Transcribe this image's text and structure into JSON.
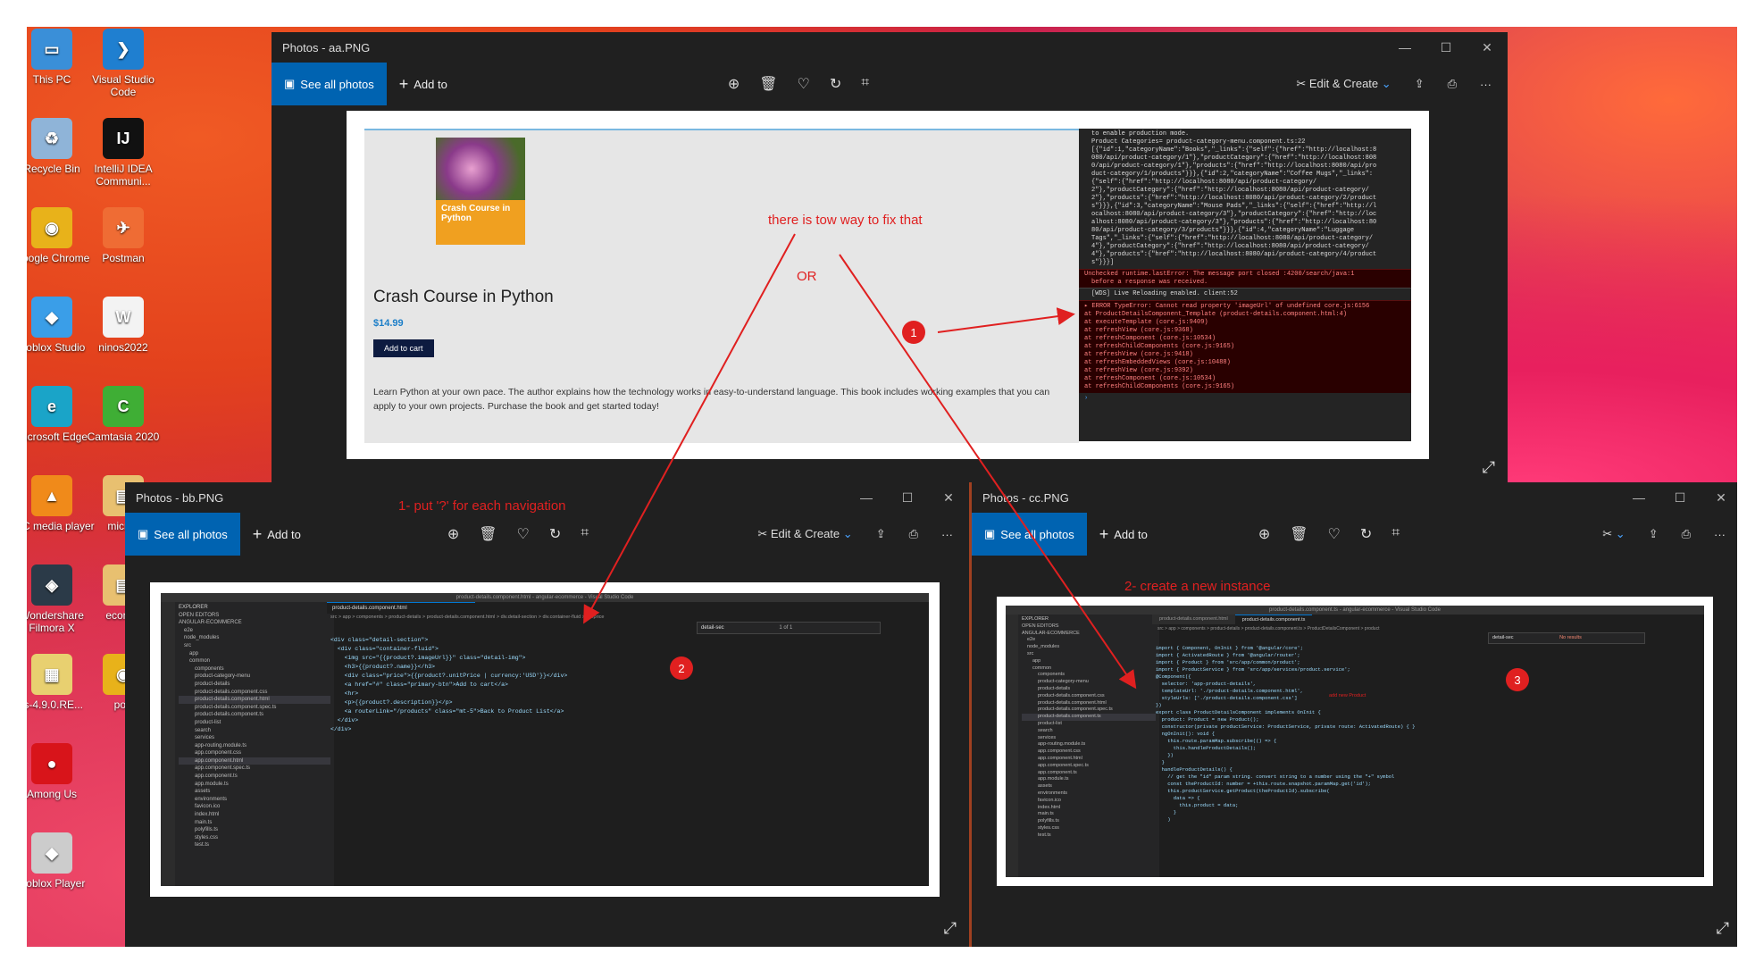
{
  "desktop_icons": [
    {
      "label": "This PC",
      "color": "#3a8fd8",
      "glyph": "▭"
    },
    {
      "label": "Visual Studio Code",
      "color": "#1f7fd0",
      "glyph": "❯"
    },
    {
      "label": "Recycle Bin",
      "color": "#8fb4d8",
      "glyph": "♻"
    },
    {
      "label": "IntelliJ IDEA Communi...",
      "color": "#111111",
      "glyph": "IJ"
    },
    {
      "label": "Google Chrome",
      "color": "#e8b21a",
      "glyph": "◉"
    },
    {
      "label": "Postman",
      "color": "#ef6c34",
      "glyph": "✈"
    },
    {
      "label": "Roblox Studio",
      "color": "#3a9ee8",
      "glyph": "◆"
    },
    {
      "label": "ninos2022",
      "color": "#f3f3f3",
      "glyph": "W"
    },
    {
      "label": "Microsoft Edge",
      "color": "#1aa4c8",
      "glyph": "e"
    },
    {
      "label": "Camtasia 2020",
      "color": "#3fae35",
      "glyph": "C"
    },
    {
      "label": "VLC media player",
      "color": "#f08a1a",
      "glyph": "▲"
    },
    {
      "label": "micros",
      "color": "#e8c070",
      "glyph": "▤"
    },
    {
      "label": "Wondershare Filmora X",
      "color": "#2b3a48",
      "glyph": "◈"
    },
    {
      "label": "ecomm",
      "color": "#e8c070",
      "glyph": "▤"
    },
    {
      "label": "ts-4.9.0.RE...",
      "color": "#e8d070",
      "glyph": "▦"
    },
    {
      "label": "port",
      "color": "#e8b21a",
      "glyph": "◉"
    },
    {
      "label": "Among Us",
      "color": "#d8141a",
      "glyph": "●"
    },
    {
      "label": "Roblox Player",
      "color": "#cccccc",
      "glyph": "◆"
    }
  ],
  "windows": {
    "aa": {
      "title": "Photos - aa.PNG",
      "see_all": "See all photos",
      "add_to": "Add to",
      "edit_create": "Edit & Create",
      "product": {
        "cover_title": "Crash Course in Python",
        "title": "Crash Course in Python",
        "price": "$14.99",
        "cart_button": "Add to cart",
        "description": "Learn Python at your own pace. The author explains how the technology works in easy-to-understand language. This book includes working examples that you can apply to your own projects. Purchase the book and get started today!"
      },
      "console_lines": [
        "to enable production mode.",
        "Product Categories=           product-category-menu.component.ts:22",
        "[{\"id\":1,\"categoryName\":\"Books\",\"_links\":{\"self\":{\"href\":\"http://localhost:8",
        "080/api/product-category/1\"},\"productCategory\":{\"href\":\"http://localhost:808",
        "0/api/product-category/1\"},\"products\":{\"href\":\"http://localhost:8080/api/pro",
        "duct-category/1/products\"}}},{\"id\":2,\"categoryName\":\"Coffee Mugs\",\"_links\":",
        "{\"self\":{\"href\":\"http://localhost:8080/api/product-category/",
        "2\"},\"productCategory\":{\"href\":\"http://localhost:8080/api/product-category/",
        "2\"},\"products\":{\"href\":\"http://localhost:8080/api/product-category/2/product",
        "s\"}}},{\"id\":3,\"categoryName\":\"Mouse Pads\",\"_links\":{\"self\":{\"href\":\"http://l",
        "ocalhost:8080/api/product-category/3\"},\"productCategory\":{\"href\":\"http://loc",
        "alhost:8080/api/product-category/3\"},\"products\":{\"href\":\"http://localhost:80",
        "80/api/product-category/3/products\"}}},{\"id\":4,\"categoryName\":\"Luggage",
        "Tags\",\"_links\":{\"self\":{\"href\":\"http://localhost:8080/api/product-category/",
        "4\"},\"productCategory\":{\"href\":\"http://localhost:8080/api/product-category/",
        "4\"},\"products\":{\"href\":\"http://localhost:8080/api/product-category/4/product",
        "s\"}}}]"
      ],
      "console_error1": "Unchecked runtime.lastError: The message port closed        :4200/search/java:1",
      "console_error1b": "before a response was received.",
      "console_wds": "[WDS] Live Reloading enabled.                              client:52",
      "console_error2": [
        "▸ ERROR TypeError: Cannot read property 'imageUrl' of undefined core.js:6156",
        "   at ProductDetailsComponent_Template (product-details.component.html:4)",
        "   at executeTemplate (core.js:9409)",
        "   at refreshView (core.js:9368)",
        "   at refreshComponent (core.js:10534)",
        "   at refreshChildComponents (core.js:9165)",
        "   at refreshView (core.js:9418)",
        "   at refreshEmbeddedViews (core.js:10488)",
        "   at refreshView (core.js:9392)",
        "   at refreshComponent (core.js:10534)",
        "   at refreshChildComponents (core.js:9165)"
      ]
    },
    "bb": {
      "title": "Photos - bb.PNG",
      "see_all": "See all photos",
      "add_to": "Add to",
      "edit_create": "Edit & Create",
      "vscode_title": "product-details.component.html - angular-ecommerce - Visual Studio Code",
      "tab": "product-details.component.html",
      "breadcrumb": "src > app > components > product-details > product-details.component.html > div.detail-section > div.container-fluid > div.price",
      "search_text": "detail-sec",
      "search_count": "1 of 1",
      "explorer_header": "EXPLORER",
      "files": [
        "OPEN EDITORS",
        "ANGULAR-ECOMMERCE",
        "e2e",
        "node_modules",
        "src",
        "app",
        "common",
        "components",
        "product-category-menu",
        "product-details",
        "product-details.component.css",
        "product-details.component.html",
        "product-details.component.spec.ts",
        "product-details.component.ts",
        "product-list",
        "search",
        "services",
        "app-routing.module.ts",
        "app.component.css",
        "app.component.html",
        "app.component.spec.ts",
        "app.component.ts",
        "app.module.ts",
        "assets",
        "environments",
        "favicon.ico",
        "index.html",
        "main.ts",
        "polyfills.ts",
        "styles.css",
        "test.ts"
      ],
      "code": [
        "<div class=\"detail-section\">",
        "  <div class=\"container-fluid\">",
        "",
        "    <img src=\"{{product?.imageUrl}}\" class=\"detail-img\">",
        "",
        "    <h3>{{product?.name}}</h3>",
        "    <div class=\"price\">{{product?.unitPrice | currency:'USD'}}</div>",
        "    <a href=\"#\" class=\"primary-btn\">Add to cart</a>",
        "",
        "    <hr>",
        "",
        "    <p>{{product?.description}}</p>",
        "",
        "    <a routerLink=\"/products\" class=\"mt-5\">Back to Product List</a>",
        "",
        "  </div>",
        "</div>"
      ]
    },
    "cc": {
      "title": "Photos - cc.PNG",
      "see_all": "See all photos",
      "add_to": "Add to",
      "vscode_title": "product-details.component.ts - angular-ecommerce - Visual Studio Code",
      "tabs": [
        "product-details.component.html",
        "product-details.component.ts"
      ],
      "breadcrumb": "src > app > components > product-details > product-details.component.ts > ProductDetailsComponent > product",
      "search_text": "detail-sec",
      "search_count": "No results",
      "explorer_header": "EXPLORER",
      "files": [
        "OPEN EDITORS",
        "ANGULAR-ECOMMERCE",
        "e2e",
        "node_modules",
        "src",
        "app",
        "common",
        "components",
        "product-category-menu",
        "product-details",
        "product-details.component.css",
        "product-details.component.html",
        "product-details.component.spec.ts",
        "product-details.component.ts",
        "product-list",
        "search",
        "services",
        "app-routing.module.ts",
        "app.component.css",
        "app.component.html",
        "app.component.spec.ts",
        "app.component.ts",
        "app.module.ts",
        "assets",
        "environments",
        "favicon.ico",
        "index.html",
        "main.ts",
        "polyfills.ts",
        "styles.css",
        "test.ts"
      ],
      "inline_note": "add new Product",
      "code": [
        "import { Component, OnInit } from '@angular/core';",
        "import { ActivatedRoute } from '@angular/router';",
        "import { Product } from 'src/app/common/product';",
        "import { ProductService } from 'src/app/services/product.service';",
        "",
        "@Component({",
        "  selector: 'app-product-details',",
        "  templateUrl: './product-details.component.html',",
        "  styleUrls: ['./product-details.component.css']",
        "})",
        "export class ProductDetailsComponent implements OnInit {",
        "",
        "  product: Product = new Product();",
        "",
        "  constructor(private productService: ProductService, private route: ActivatedRoute) { }",
        "",
        "  ngOnInit(): void {",
        "    this.route.paramMap.subscribe(() => {",
        "      this.handleProductDetails();",
        "    })",
        "  }",
        "",
        "  handleProductDetails() {",
        "",
        "    // get the \"id\" param string. convert string to a number using the \"+\" symbol",
        "    const theProductId: number = +this.route.snapshot.paramMap.get('id');",
        "",
        "    this.productService.getProduct(theProductId).subscribe(",
        "      data => {",
        "        this.product = data;",
        "      }",
        "    )"
      ]
    }
  },
  "annotations": {
    "top_note": "there is tow way to fix that",
    "or": "OR",
    "note1": "1- put '?' for each navigation",
    "note2": "2- create a new instance",
    "badge1": "1",
    "badge2": "2",
    "badge3": "3"
  },
  "colors": {
    "accent": "#0063b1",
    "annotation": "#e02020",
    "window_bg": "#202020",
    "console_error_bg": "#290000"
  }
}
